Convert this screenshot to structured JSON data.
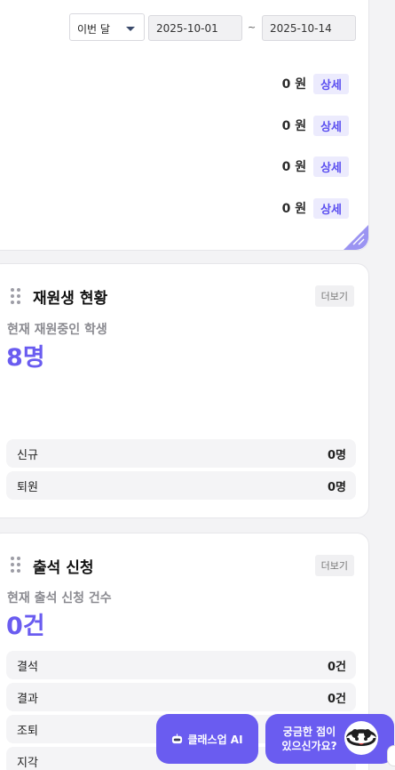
{
  "filter": {
    "period_select": "이번 달",
    "date_from": "2025-10-01",
    "date_separator": "~",
    "date_to": "2025-10-14"
  },
  "amounts": [
    {
      "value": "0 원",
      "detail_label": "상세"
    },
    {
      "value": "0 원",
      "detail_label": "상세"
    },
    {
      "value": "0 원",
      "detail_label": "상세"
    },
    {
      "value": "0 원",
      "detail_label": "상세"
    }
  ],
  "students": {
    "title": "재원생 현황",
    "more_label": "더보기",
    "subtitle": "현재 재원중인 학생",
    "count": "8명",
    "rows": [
      {
        "label": "신규",
        "value": "0명"
      },
      {
        "label": "퇴원",
        "value": "0명"
      }
    ]
  },
  "attendance": {
    "title": "출석 신청",
    "more_label": "더보기",
    "subtitle": "현재 출석 신청 건수",
    "count": "0건",
    "rows": [
      {
        "label": "결석",
        "value": "0건"
      },
      {
        "label": "결과",
        "value": "0건"
      },
      {
        "label": "조퇴",
        "value": ""
      },
      {
        "label": "지각",
        "value": ""
      }
    ]
  },
  "floating": {
    "ai_label": "클래스업 AI",
    "ask_line1": "궁금한 점이",
    "ask_line2": "있으신가요?"
  },
  "colors": {
    "accent": "#6a5cf0",
    "detail_bg": "#ecebfd"
  }
}
